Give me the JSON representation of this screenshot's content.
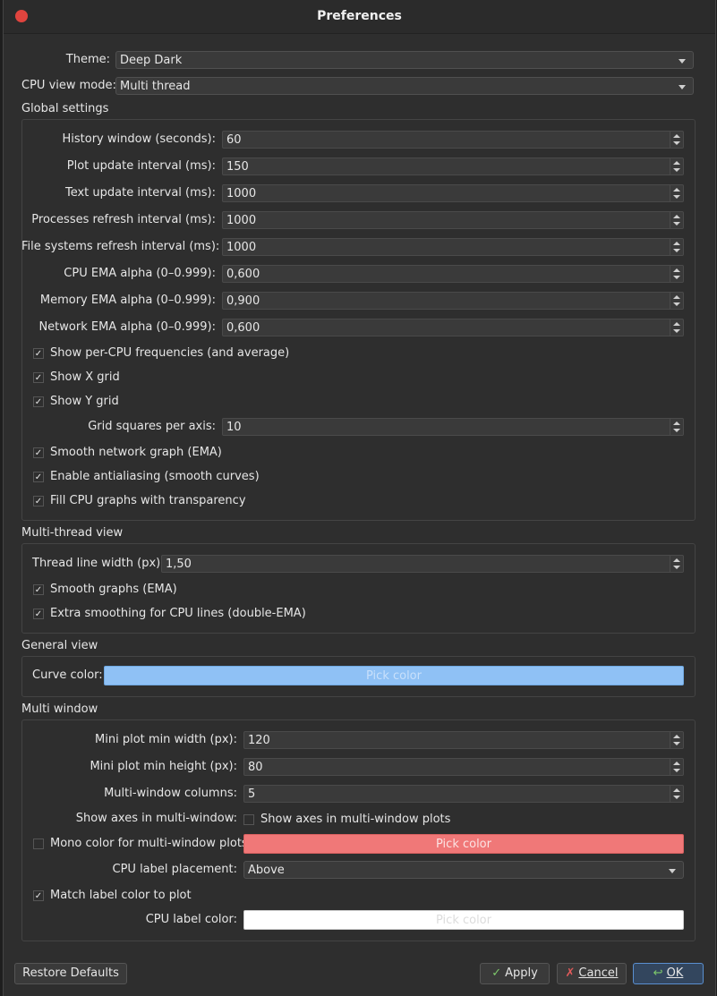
{
  "window": {
    "title": "Preferences"
  },
  "theme": {
    "label": "Theme:",
    "value": "Deep Dark"
  },
  "cpu_view_mode": {
    "label": "CPU view mode:",
    "value": "Multi thread"
  },
  "global": {
    "title": "Global settings",
    "history_window": {
      "label": "History window (seconds):",
      "value": "60"
    },
    "plot_update": {
      "label": "Plot update interval (ms):",
      "value": "150"
    },
    "text_update": {
      "label": "Text update interval (ms):",
      "value": "1000"
    },
    "processes_refresh": {
      "label": "Processes refresh interval (ms):",
      "value": "1000"
    },
    "fs_refresh": {
      "label": "File systems refresh interval (ms):",
      "value": "1000"
    },
    "cpu_ema": {
      "label": "CPU EMA alpha (0–0.999):",
      "value": "0,600"
    },
    "mem_ema": {
      "label": "Memory EMA alpha (0–0.999):",
      "value": "0,900"
    },
    "net_ema": {
      "label": "Network EMA alpha (0–0.999):",
      "value": "0,600"
    },
    "show_per_cpu": {
      "label": "Show per-CPU frequencies (and average)",
      "checked": true
    },
    "show_x_grid": {
      "label": "Show X grid",
      "checked": true
    },
    "show_y_grid": {
      "label": "Show Y grid",
      "checked": true
    },
    "grid_squares": {
      "label": "Grid squares per axis:",
      "value": "10"
    },
    "smooth_network": {
      "label": "Smooth network graph (EMA)",
      "checked": true
    },
    "antialiasing": {
      "label": "Enable antialiasing (smooth curves)",
      "checked": true
    },
    "fill_cpu": {
      "label": "Fill CPU graphs with transparency",
      "checked": true
    }
  },
  "multithread": {
    "title": "Multi-thread view",
    "line_width": {
      "label": "Thread line width (px):",
      "value": "1,50"
    },
    "smooth_graphs": {
      "label": "Smooth graphs (EMA)",
      "checked": true
    },
    "extra_smoothing": {
      "label": "Extra smoothing for CPU lines (double-EMA)",
      "checked": true
    }
  },
  "general": {
    "title": "General view",
    "curve_color": {
      "label": "Curve color:",
      "button": "Pick color",
      "color": "#8fc1f5"
    }
  },
  "multiwindow": {
    "title": "Multi window",
    "min_width": {
      "label": "Mini plot min width (px):",
      "value": "120"
    },
    "min_height": {
      "label": "Mini plot min height (px):",
      "value": "80"
    },
    "columns": {
      "label": "Multi-window columns:",
      "value": "5"
    },
    "show_axes": {
      "label": "Show axes in multi-window:",
      "checkbox_label": "Show axes in multi-window plots",
      "checked": false
    },
    "mono_color": {
      "label": "Mono color for multi-window plots",
      "checked": false,
      "button": "Pick color",
      "color": "#f07878"
    },
    "label_placement": {
      "label": "CPU label placement:",
      "value": "Above"
    },
    "match_label": {
      "label": "Match label color to plot",
      "checked": true
    },
    "label_color": {
      "label": "CPU label color:",
      "button": "Pick color",
      "color": "#ffffff"
    }
  },
  "buttons": {
    "restore": "Restore Defaults",
    "apply": "Apply",
    "cancel": "Cancel",
    "ok": "OK"
  }
}
